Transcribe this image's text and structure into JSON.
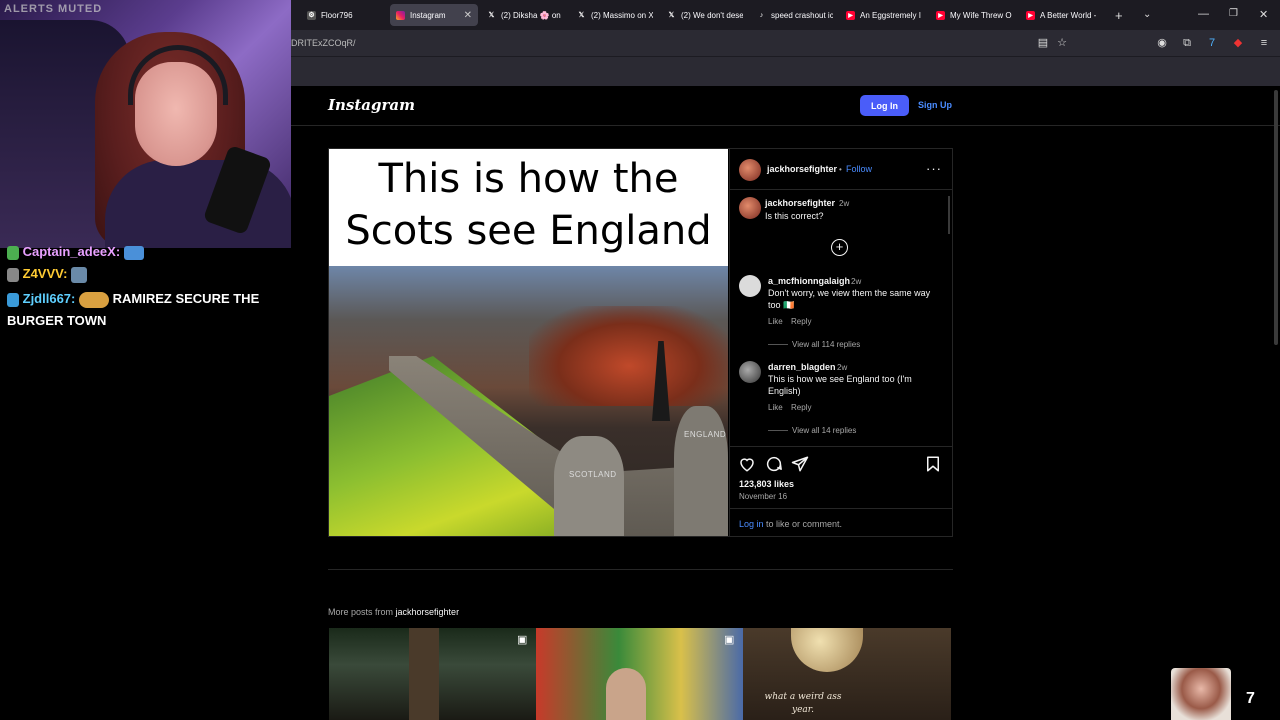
{
  "stream": {
    "alerts_text": "ALERTS MUTED",
    "chat": [
      {
        "name": "Captain_adeeX:",
        "message": ""
      },
      {
        "name": "Z4VVV:",
        "message": ""
      },
      {
        "name": "Zjdll667:",
        "message": "RAMIREZ SECURE THE BURGER TOWN"
      }
    ],
    "pip_count": "7"
  },
  "browser": {
    "tabs": [
      {
        "label": "Floor796",
        "icon": "floor-icon"
      },
      {
        "label": "Instagram",
        "icon": "instagram-icon",
        "active": true
      },
      {
        "label": "(2) Diksha 🌸 on",
        "icon": "x-icon"
      },
      {
        "label": "(2) Massimo on X",
        "icon": "x-icon"
      },
      {
        "label": "(2) We don't dese",
        "icon": "x-icon"
      },
      {
        "label": "speed crashout ic",
        "icon": "tiktok-icon"
      },
      {
        "label": "An Eggstremely I",
        "icon": "youtube-icon"
      },
      {
        "label": "My Wife Threw O",
        "icon": "youtube-icon"
      },
      {
        "label": "A Better World - ",
        "icon": "youtube-icon"
      }
    ],
    "url": "DRITExZCOqR/",
    "new_tab": "+"
  },
  "instagram": {
    "logo": "Instagram",
    "login_label": "Log In",
    "signup_label": "Sign Up",
    "post": {
      "username": "jackhorsefighter",
      "follow_label": "Follow",
      "separator": "•",
      "caption": {
        "username": "jackhorsefighter",
        "time": "2w",
        "text": "Is this correct?"
      },
      "meme_title": "This is how the Scots see England",
      "meme_labels": {
        "left": "SCOTLAND",
        "right": "ENGLAND"
      },
      "comments": [
        {
          "username": "a_mcfhionngalaigh",
          "time": "2w",
          "text": "Don't worry, we view them the same way too 🇮🇪",
          "like": "Like",
          "reply": "Reply",
          "replies": "View all 114 replies"
        },
        {
          "username": "darren_blagden",
          "time": "2w",
          "text": "This is how we see England too (I'm English)",
          "like": "Like",
          "reply": "Reply",
          "replies": "View all 14 replies"
        }
      ],
      "likes": "123,803 likes",
      "date": "November 16",
      "login_prompt_link": "Log in",
      "login_prompt_rest": " to like or comment."
    },
    "more_posts_prefix": "More posts from ",
    "more_posts_user": "jackhorsefighter",
    "thumb3_caption": "what a weird ass year."
  }
}
